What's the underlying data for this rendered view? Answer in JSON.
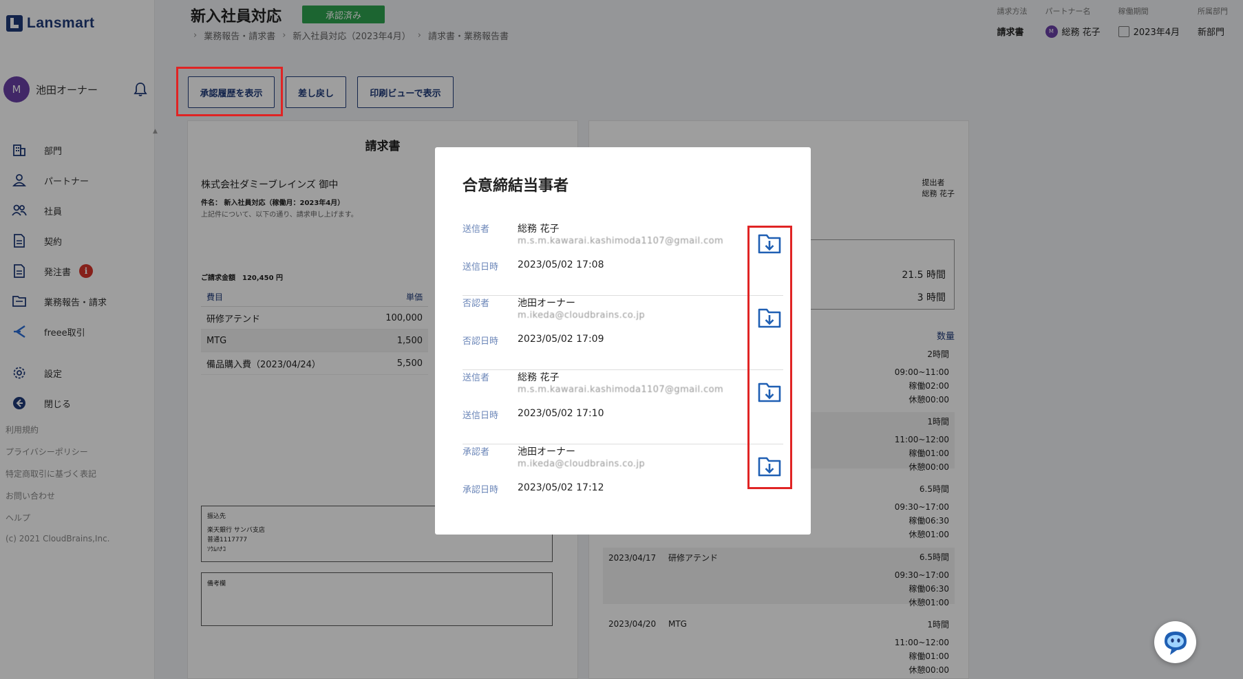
{
  "app": {
    "logo_text": "Lansmart"
  },
  "user": {
    "initial": "M",
    "name": "池田オーナー"
  },
  "nav": [
    {
      "label": "部門",
      "icon": "building-icon"
    },
    {
      "label": "パートナー",
      "icon": "person-icon"
    },
    {
      "label": "社員",
      "icon": "people-icon"
    },
    {
      "label": "契約",
      "icon": "document-icon"
    },
    {
      "label": "発注書",
      "icon": "document-icon",
      "alert": "i"
    },
    {
      "label": "業務報告・請求",
      "icon": "folder-icon"
    },
    {
      "label": "freee取引",
      "icon": "freee-icon"
    },
    {
      "label": "設定",
      "icon": "gear-icon"
    },
    {
      "label": "閉じる",
      "icon": "back-arrow-icon"
    }
  ],
  "footer_links": [
    "利用規約",
    "プライバシーポリシー",
    "特定商取引に基づく表記",
    "お問い合わせ",
    "ヘルプ",
    "(c) 2021 CloudBrains,Inc."
  ],
  "header": {
    "title": "新入社員対応",
    "status": "承認済み",
    "breadcrumb": [
      "業務報告・請求書",
      "新入社員対応（2023年4月）",
      "請求書・業務報告書"
    ],
    "meta": {
      "billing_method_label": "請求方法",
      "billing_method": "請求書",
      "partner_label": "パートナー名",
      "partner": "総務 花子",
      "partner_initial": "M",
      "period_label": "稼働期間",
      "period": "2023年4月",
      "dept_label": "所属部門",
      "dept": "新部門"
    }
  },
  "actions": {
    "history": "承認履歴を表示",
    "return": "差し戻し",
    "print": "印刷ビューで表示"
  },
  "invoice": {
    "title": "請求書",
    "client": "株式会社ダミーブレインズ 御中",
    "subject": "件名： 新入社員対応（稼働月：2023年4月）",
    "note": "上記件について、以下の通り、請求申し上げます。",
    "total": "ご請求金額　120,450 円",
    "col_item": "費目",
    "col_price": "単価",
    "rows": [
      {
        "item": "研修アテンド",
        "price": "100,000"
      },
      {
        "item": "MTG",
        "price": "1,500"
      },
      {
        "item": "備品購入費（2023/04/24）",
        "price": "5,500"
      }
    ],
    "bank_label": "振込先",
    "bank_name": "楽天銀行 サンバ支店",
    "bank_account": "普通1117777",
    "bank_holder": "ｿｳﾑﾊﾅｺ",
    "remarks_label": "備考欄"
  },
  "report": {
    "submitter_label": "提出者",
    "submitter": "総務 花子",
    "total_hours": "21.5 時間",
    "sub_hours": "3 時間",
    "qty_header": "数量",
    "entries": [
      {
        "date": "",
        "task": "",
        "hours": "2時間",
        "lines": [
          "09:00~11:00",
          "稼働02:00",
          "休憩00:00"
        ]
      },
      {
        "date": "",
        "task": "",
        "hours": "1時間",
        "lines": [
          "11:00~12:00",
          "稼働01:00",
          "休憩00:00"
        ]
      },
      {
        "date": "",
        "task": "",
        "hours": "6.5時間",
        "lines": [
          "09:30~17:00",
          "稼働06:30",
          "休憩01:00"
        ]
      },
      {
        "date": "2023/04/17",
        "task": "研修アテンド",
        "hours": "6.5時間",
        "lines": [
          "09:30~17:00",
          "稼働06:30",
          "休憩01:00"
        ]
      },
      {
        "date": "2023/04/20",
        "task": "MTG",
        "hours": "1時間",
        "lines": [
          "11:00~12:00",
          "稼働01:00",
          "休憩00:00"
        ]
      }
    ]
  },
  "modal": {
    "title": "合意締結当事者",
    "parties": [
      {
        "role": "送信者",
        "name": "総務 花子",
        "email": "m.s.m.kawarai.kashimoda1107@gmail.com",
        "date_label": "送信日時",
        "date": "2023/05/02 17:08"
      },
      {
        "role": "否認者",
        "name": "池田オーナー",
        "email": "m.ikeda@cloudbrains.co.jp",
        "date_label": "否認日時",
        "date": "2023/05/02 17:09"
      },
      {
        "role": "送信者",
        "name": "総務 花子",
        "email": "m.s.m.kawarai.kashimoda1107@gmail.com",
        "date_label": "送信日時",
        "date": "2023/05/02 17:10"
      },
      {
        "role": "承認者",
        "name": "池田オーナー",
        "email": "m.ikeda@cloudbrains.co.jp",
        "date_label": "承認日時",
        "date": "2023/05/02 17:12"
      }
    ]
  },
  "colors": {
    "brand": "#1f3a7a",
    "approved": "#2ea44f",
    "highlight": "#e02424",
    "alert": "#d9352a"
  }
}
